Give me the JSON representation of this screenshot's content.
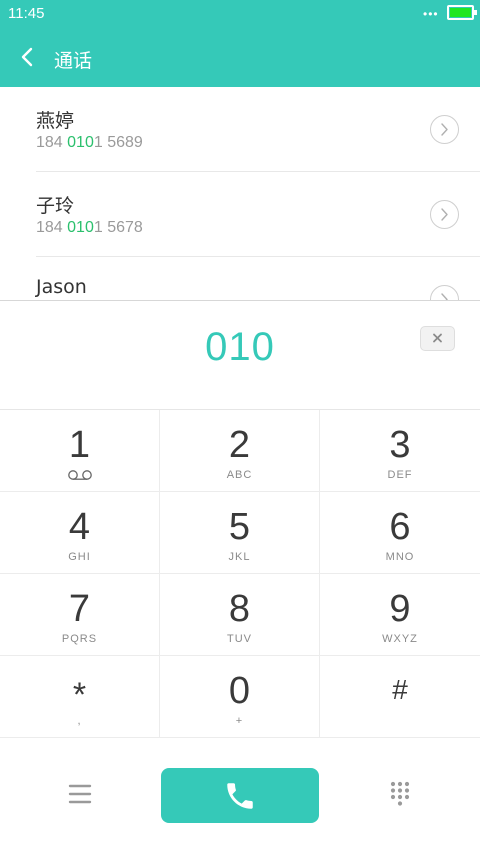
{
  "status_bar": {
    "time": "11:45",
    "dots": "•••"
  },
  "header": {
    "title": "通话"
  },
  "contacts": [
    {
      "name": "燕婷",
      "number_prefix": "184 ",
      "number_match": "010",
      "number_suffix": "1 5689"
    },
    {
      "name": "子玲",
      "number_prefix": "184 ",
      "number_match": "010",
      "number_suffix": "1 5678"
    },
    {
      "name": "Jason",
      "number_prefix": "",
      "number_match": "",
      "number_suffix": ""
    }
  ],
  "dialed": {
    "number": "010"
  },
  "keypad": {
    "keys": [
      {
        "digit": "1",
        "letters": ""
      },
      {
        "digit": "2",
        "letters": "ABC"
      },
      {
        "digit": "3",
        "letters": "DEF"
      },
      {
        "digit": "4",
        "letters": "GHI"
      },
      {
        "digit": "5",
        "letters": "JKL"
      },
      {
        "digit": "6",
        "letters": "MNO"
      },
      {
        "digit": "7",
        "letters": "PQRS"
      },
      {
        "digit": "8",
        "letters": "TUV"
      },
      {
        "digit": "9",
        "letters": "WXYZ"
      },
      {
        "digit": "*",
        "letters": ","
      },
      {
        "digit": "0",
        "letters": "+"
      },
      {
        "digit": "#",
        "letters": ""
      }
    ]
  },
  "icons": {
    "back": "back-arrow-icon",
    "detail": "chevron-right-icon",
    "delete": "backspace-icon",
    "voicemail": "voicemail-icon",
    "menu": "menu-icon",
    "call": "phone-icon",
    "keypad_toggle": "dialpad-icon"
  },
  "colors": {
    "accent": "#35c9b8",
    "match_highlight": "#2bc06d",
    "battery": "#22e622",
    "text_primary": "#333333",
    "text_secondary": "#9a9a9a"
  }
}
